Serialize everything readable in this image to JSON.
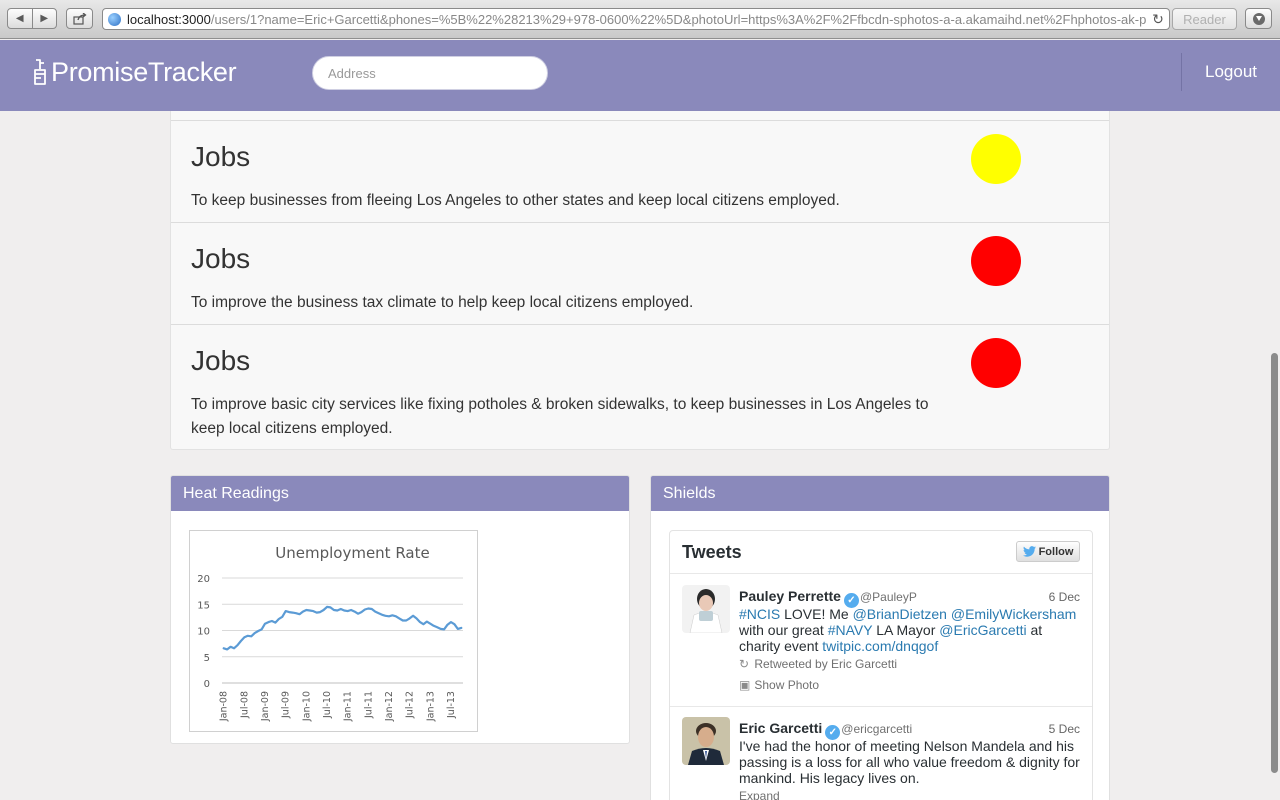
{
  "browser": {
    "url_host": "localhost:3000",
    "url_rest": "/users/1?name=Eric+Garcetti&phones=%5B%22%28213%29+978-0600%22%5D&photoUrl=https%3A%2F%2Ffbcdn-sphotos-a-a.akamaihd.net%2Fhphotos-ak-p",
    "reader_label": "Reader"
  },
  "header": {
    "logo_text": "PromiseTracker",
    "address_placeholder": "Address",
    "logout_label": "Logout",
    "background": "#8a89bb"
  },
  "promises": [
    {
      "title": "Jobs",
      "description": "To keep businesses from fleeing Los Angeles to other states and keep local citizens employed.",
      "status_color": "#ffff00"
    },
    {
      "title": "Jobs",
      "description": "To improve the business tax climate to help keep local citizens employed.",
      "status_color": "#ff0000"
    },
    {
      "title": "Jobs",
      "description": "To improve basic city services like fixing potholes & broken sidewalks, to keep businesses in Los Angeles to keep local citizens employed.",
      "status_color": "#ff0000"
    }
  ],
  "heat_panel": {
    "title": "Heat Readings"
  },
  "chart_data": {
    "type": "line",
    "title": "Unemployment Rate",
    "xlabel": "",
    "ylabel": "",
    "ylim": [
      0,
      20
    ],
    "yticks": [
      0,
      5,
      10,
      15,
      20
    ],
    "x_tick_labels": [
      "Jan-08",
      "Jul-08",
      "Jan-09",
      "Jul-09",
      "Jan-10",
      "Jul-10",
      "Jan-11",
      "Jul-11",
      "Jan-12",
      "Jul-12",
      "Jan-13",
      "Jul-13"
    ],
    "grid": true,
    "line_color": "#5b9bd5",
    "series": [
      {
        "x": [
          "Jan-08",
          "Feb-08",
          "Mar-08",
          "Apr-08",
          "May-08",
          "Jun-08",
          "Jul-08",
          "Aug-08",
          "Sep-08",
          "Oct-08",
          "Nov-08",
          "Dec-08",
          "Jan-09",
          "Feb-09",
          "Mar-09",
          "Apr-09",
          "May-09",
          "Jun-09",
          "Jul-09",
          "Aug-09",
          "Sep-09",
          "Oct-09",
          "Nov-09",
          "Dec-09",
          "Jan-10",
          "Feb-10",
          "Mar-10",
          "Apr-10",
          "May-10",
          "Jun-10",
          "Jul-10",
          "Aug-10",
          "Sep-10",
          "Oct-10",
          "Nov-10",
          "Dec-10",
          "Jan-11",
          "Feb-11",
          "Mar-11",
          "Apr-11",
          "May-11",
          "Jun-11",
          "Jul-11",
          "Aug-11",
          "Sep-11",
          "Oct-11",
          "Nov-11",
          "Dec-11",
          "Jan-12",
          "Feb-12",
          "Mar-12",
          "Apr-12",
          "May-12",
          "Jun-12",
          "Jul-12",
          "Aug-12",
          "Sep-12",
          "Oct-12",
          "Nov-12",
          "Dec-12",
          "Jan-13",
          "Feb-13",
          "Mar-13",
          "Apr-13",
          "May-13",
          "Jun-13",
          "Jul-13",
          "Aug-13",
          "Sep-13",
          "Oct-13"
        ],
        "values": [
          6.6,
          6.4,
          6.9,
          6.6,
          7.2,
          8.0,
          8.7,
          9.0,
          8.9,
          9.5,
          9.9,
          10.2,
          11.3,
          11.6,
          11.8,
          11.5,
          12.2,
          12.6,
          13.7,
          13.5,
          13.4,
          13.3,
          13.1,
          13.6,
          13.9,
          13.8,
          13.7,
          13.4,
          13.5,
          13.9,
          14.5,
          14.4,
          13.9,
          13.8,
          14.1,
          13.8,
          13.7,
          13.9,
          13.6,
          13.2,
          13.5,
          14.0,
          14.2,
          14.1,
          13.6,
          13.3,
          13.0,
          12.8,
          12.7,
          12.9,
          12.7,
          12.3,
          11.9,
          11.9,
          12.3,
          12.8,
          12.3,
          11.6,
          11.2,
          11.7,
          11.3,
          10.9,
          10.6,
          10.3,
          10.2,
          11.1,
          11.6,
          11.2,
          10.3,
          10.5
        ]
      }
    ]
  },
  "shields_panel": {
    "title": "Shields",
    "widget_title": "Tweets",
    "follow_label": "Follow",
    "tweets": [
      {
        "name": "Pauley Perrette",
        "handle": "@PauleyP",
        "date": "6 Dec",
        "segments": [
          {
            "text": "#NCIS",
            "entity": true
          },
          {
            "text": " LOVE! Me ",
            "entity": false
          },
          {
            "text": "@BrianDietzen",
            "entity": true
          },
          {
            "text": " ",
            "entity": false
          },
          {
            "text": "@EmilyWickersham",
            "entity": true
          },
          {
            "text": " with our great  ",
            "entity": false
          },
          {
            "text": "#NAVY",
            "entity": true
          },
          {
            "text": " LA Mayor ",
            "entity": false
          },
          {
            "text": "@EricGarcetti",
            "entity": true
          },
          {
            "text": " at charity event ",
            "entity": false
          },
          {
            "text": "twitpic.com/dnqgof",
            "entity": true
          }
        ],
        "retweet_note": "Retweeted by Eric Garcetti",
        "action": "Show Photo"
      },
      {
        "name": "Eric Garcetti",
        "handle": "@ericgarcetti",
        "date": "5 Dec",
        "segments": [
          {
            "text": "I've had the honor of meeting Nelson Mandela and his passing is a loss for all who value freedom & dignity for mankind. His legacy lives on.",
            "entity": false
          }
        ],
        "action": "Expand"
      }
    ]
  }
}
